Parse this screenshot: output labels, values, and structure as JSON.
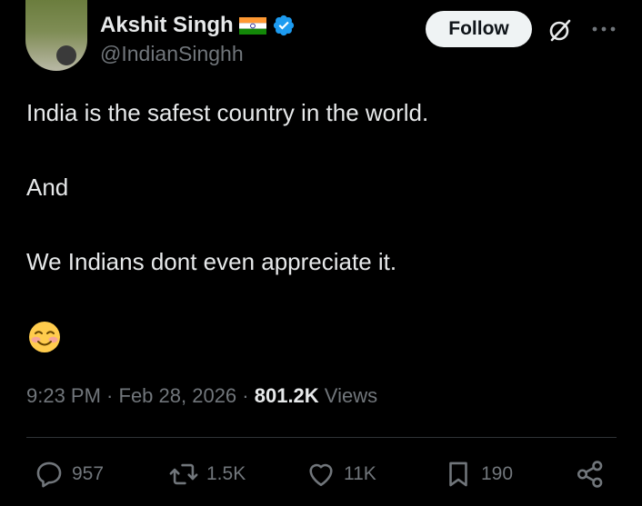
{
  "author": {
    "name": "Akshit Singh",
    "handle": "@IndianSinghh",
    "flag_icon": "india-flag-icon",
    "verified_icon": "verified-badge-icon"
  },
  "header": {
    "follow_label": "Follow",
    "grok_icon": "grok-icon",
    "more_icon": "more-options-icon"
  },
  "tweet": {
    "lines": [
      "India is the safest country in the world.",
      "And",
      "We Indians dont even appreciate it."
    ],
    "emoji": "smiling-face-icon"
  },
  "meta": {
    "time": "9:23 PM",
    "sep1": " · ",
    "date": "Feb 28, 2026",
    "sep2": " · ",
    "views_count": "801.2K",
    "views_label": " Views"
  },
  "actions": {
    "reply_count": "957",
    "repost_count": "1.5K",
    "like_count": "11K",
    "bookmark_count": "190"
  },
  "colors": {
    "background": "#000000",
    "text_primary": "#e7e9ea",
    "text_secondary": "#71767b",
    "verified": "#1d9bf0",
    "button_bg": "#eff3f4"
  }
}
